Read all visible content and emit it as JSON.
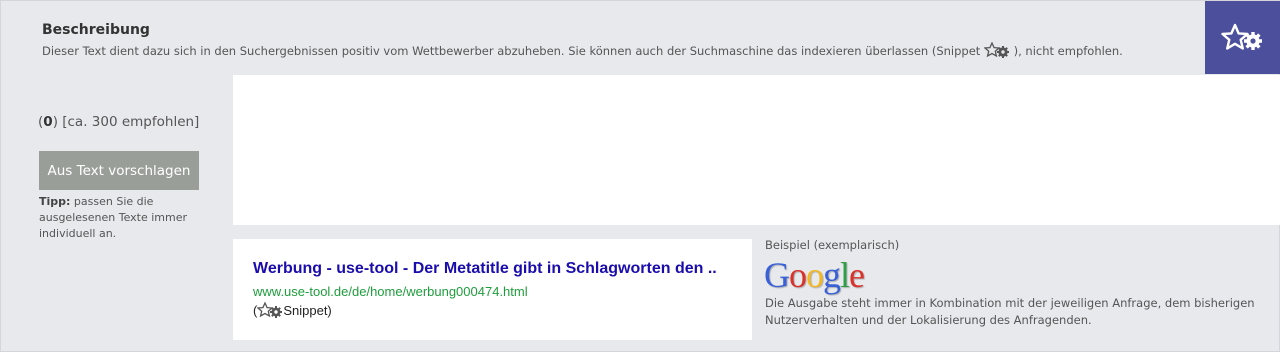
{
  "header": {
    "title": "Beschreibung",
    "desc_before": "Dieser Text dient dazu sich in den Suchergebnissen positiv vom Wettbewerber abzuheben. Sie können auch der Suchmaschine das indexieren überlassen (Snippet",
    "desc_after": "), nicht empfohlen."
  },
  "badge": {
    "icon": "star-gear-icon",
    "color": "#4c4f9c"
  },
  "counter": {
    "open": "(",
    "count": "0",
    "close": ") [ca. 300 empfohlen]"
  },
  "suggest_button": {
    "label": "Aus Text vorschlagen"
  },
  "tip": {
    "label": "Tipp:",
    "text": " passen Sie die ausgelesenen Texte immer individuell an."
  },
  "description_input": {
    "value": "",
    "placeholder": ""
  },
  "preview": {
    "title": "Werbung - use-tool - Der Metatitle gibt in Schlagworten den ..",
    "url": "www.use-tool.de/de/home/werbung000474.html",
    "snippet_open": "(",
    "snippet_label": "Snippet)"
  },
  "example": {
    "label": "Beispiel (exemplarisch)",
    "logo_letters": [
      "G",
      "o",
      "o",
      "g",
      "l",
      "e"
    ],
    "logo_colors": [
      "#3a62d6",
      "#d8322a",
      "#f2b824",
      "#3a62d6",
      "#2f9e44",
      "#d8322a"
    ],
    "note": "Die Ausgabe steht immer in Kombination mit der jeweiligen Anfrage, dem bisherigen Nutzerverhalten und der Lokalisierung des Anfragenden."
  }
}
